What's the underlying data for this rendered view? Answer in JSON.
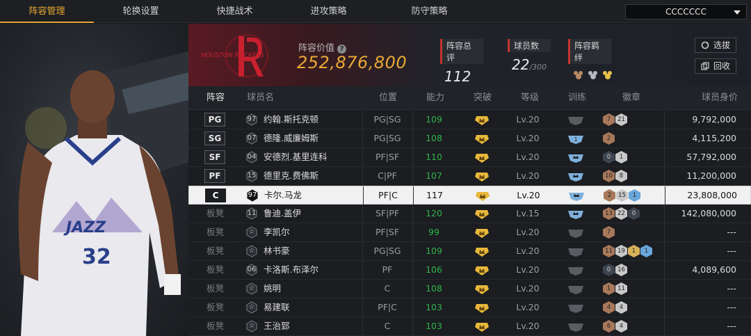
{
  "nav": {
    "tabs": [
      {
        "label": "阵容管理",
        "active": true
      },
      {
        "label": "轮换设置",
        "active": false
      },
      {
        "label": "快捷战术",
        "active": false
      },
      {
        "label": "进攻策略",
        "active": false
      },
      {
        "label": "防守策略",
        "active": false
      }
    ],
    "team_select": "CCCCCCC"
  },
  "portrait": {
    "jersey_number": "32",
    "jersey_text": "JAZZ"
  },
  "team": {
    "logo_text": "HOUSTON ROCKETS",
    "value_label": "阵容价值",
    "value": "252,876,800",
    "overall_label": "阵容总评",
    "overall": "112",
    "players_label": "球员数",
    "players": "22",
    "players_max": "/300",
    "bond_label": "阵容羁绊",
    "btn_select": "选拔",
    "btn_recycle": "回收"
  },
  "columns": [
    "阵容",
    "球员名",
    "位置",
    "能力",
    "突破",
    "等级",
    "训练",
    "徽章",
    "球员身价"
  ],
  "colors": {
    "accent": "#e8a934",
    "rating_green": "#2fb54a",
    "red_bar": "#c2342e"
  },
  "rows": [
    {
      "slot": "PG",
      "num": "97",
      "name": "约翰.斯托克顿",
      "pos": "PG|SG",
      "rating": "109",
      "rating_green": true,
      "level": "Lv.20",
      "train": "gray",
      "badges": [
        [
          "bronze",
          "7"
        ],
        [
          "silver",
          "21"
        ]
      ],
      "value": "9,792,000"
    },
    {
      "slot": "SG",
      "num": "07",
      "name": "德隆.威廉姆斯",
      "pos": "PG|SG",
      "rating": "108",
      "rating_green": true,
      "level": "Lv.20",
      "train": "blue1",
      "badges": [
        [
          "bronze",
          "2"
        ]
      ],
      "value": "4,115,200"
    },
    {
      "slot": "SF",
      "num": "04",
      "name": "安德烈.基里连科",
      "pos": "PF|SF",
      "rating": "110",
      "rating_green": true,
      "level": "Lv.20",
      "train": "blue",
      "badges": [
        [
          "dark",
          "0"
        ],
        [
          "silver",
          "1"
        ]
      ],
      "value": "57,792,000"
    },
    {
      "slot": "PF",
      "num": "15",
      "name": "德里克.费佛斯",
      "pos": "C|PF",
      "rating": "107",
      "rating_green": true,
      "level": "Lv.20",
      "train": "blue",
      "badges": [
        [
          "bronze",
          "10"
        ],
        [
          "silver",
          "8"
        ]
      ],
      "value": "11,200,000"
    },
    {
      "slot": "C",
      "num": "97",
      "name": "卡尔.马龙",
      "pos": "PF|C",
      "rating": "117",
      "rating_green": false,
      "level": "Lv.20",
      "train": "blue",
      "badges": [
        [
          "bronze",
          "2"
        ],
        [
          "silver",
          "15"
        ],
        [
          "blue",
          "1"
        ]
      ],
      "value": "23,808,000",
      "selected": true
    },
    {
      "slot": "板凳",
      "num": "11",
      "name": "鲁迪.盖伊",
      "pos": "SF|PF",
      "rating": "120",
      "rating_green": true,
      "level": "Lv.15",
      "train": "blue",
      "badges": [
        [
          "bronze",
          "13"
        ],
        [
          "silver",
          "22"
        ],
        [
          "dark",
          "0"
        ]
      ],
      "value": "142,080,000"
    },
    {
      "slot": "板凳",
      "num": "☆",
      "name": "李凯尔",
      "pos": "PF|SF",
      "rating": "99",
      "rating_green": true,
      "level": "Lv.20",
      "train": "gray",
      "badges": [
        [
          "bronze",
          "7"
        ]
      ],
      "value": "---"
    },
    {
      "slot": "板凳",
      "num": "☆",
      "name": "林书豪",
      "pos": "PG|SG",
      "rating": "109",
      "rating_green": true,
      "level": "Lv.20",
      "train": "gray",
      "badges": [
        [
          "bronze",
          "11"
        ],
        [
          "silver",
          "19"
        ],
        [
          "gold",
          "1"
        ],
        [
          "blue",
          "1"
        ]
      ],
      "value": "---"
    },
    {
      "slot": "板凳",
      "num": "06",
      "name": "卡洛斯.布泽尔",
      "pos": "PF",
      "rating": "106",
      "rating_green": true,
      "level": "Lv.20",
      "train": "gray",
      "badges": [
        [
          "dark",
          "0"
        ],
        [
          "silver",
          "16"
        ]
      ],
      "value": "4,089,600"
    },
    {
      "slot": "板凳",
      "num": "☆",
      "name": "姚明",
      "pos": "C",
      "rating": "108",
      "rating_green": true,
      "level": "Lv.20",
      "train": "gray",
      "badges": [
        [
          "bronze",
          "1"
        ],
        [
          "silver",
          "11"
        ]
      ],
      "value": "---"
    },
    {
      "slot": "板凳",
      "num": "☆",
      "name": "易建联",
      "pos": "PF|C",
      "rating": "103",
      "rating_green": true,
      "level": "Lv.20",
      "train": "gray",
      "badges": [
        [
          "bronze",
          "4"
        ],
        [
          "silver",
          "4"
        ]
      ],
      "value": "---"
    },
    {
      "slot": "板凳",
      "num": "☆",
      "name": "王治郅",
      "pos": "C",
      "rating": "103",
      "rating_green": true,
      "level": "Lv.20",
      "train": "gray",
      "badges": [
        [
          "bronze",
          "6"
        ],
        [
          "silver",
          "4"
        ]
      ],
      "value": "---"
    }
  ]
}
